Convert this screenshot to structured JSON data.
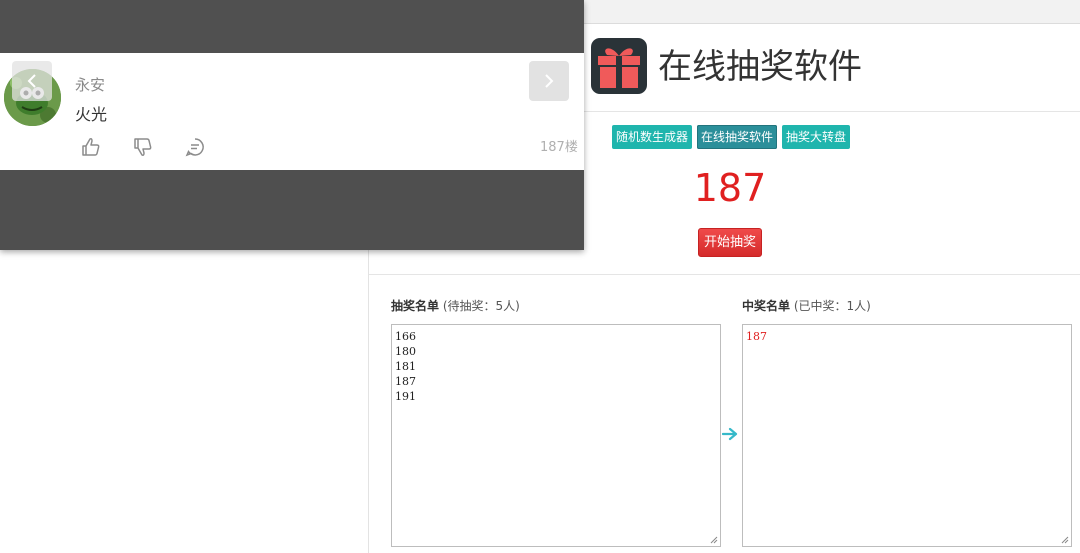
{
  "app": {
    "title": "在线抽奖软件",
    "nav": [
      {
        "label": "随机数生成器",
        "active": false
      },
      {
        "label": "在线抽奖软件",
        "active": true
      },
      {
        "label": "抽奖大转盘",
        "active": false
      }
    ],
    "result": "187",
    "start_button": "开始抽奖",
    "candidates": {
      "title": "抽奖名单",
      "status": "(待抽奖：5人)",
      "items": [
        "166",
        "180",
        "181",
        "187",
        "191"
      ]
    },
    "winners": {
      "title": "中奖名单",
      "status": "(已中奖：1人)",
      "items": [
        "187"
      ]
    },
    "colors": {
      "accent": "#1fb5ad",
      "active": "#2b8f9a",
      "result": "#e02020",
      "start": "#e03535"
    }
  },
  "comment": {
    "username": "永安",
    "text": "火光",
    "floor": "187楼",
    "icons": [
      "thumbs-up-icon",
      "thumbs-down-icon",
      "reply-icon",
      "chevron-left-icon",
      "chevron-right-icon"
    ]
  }
}
